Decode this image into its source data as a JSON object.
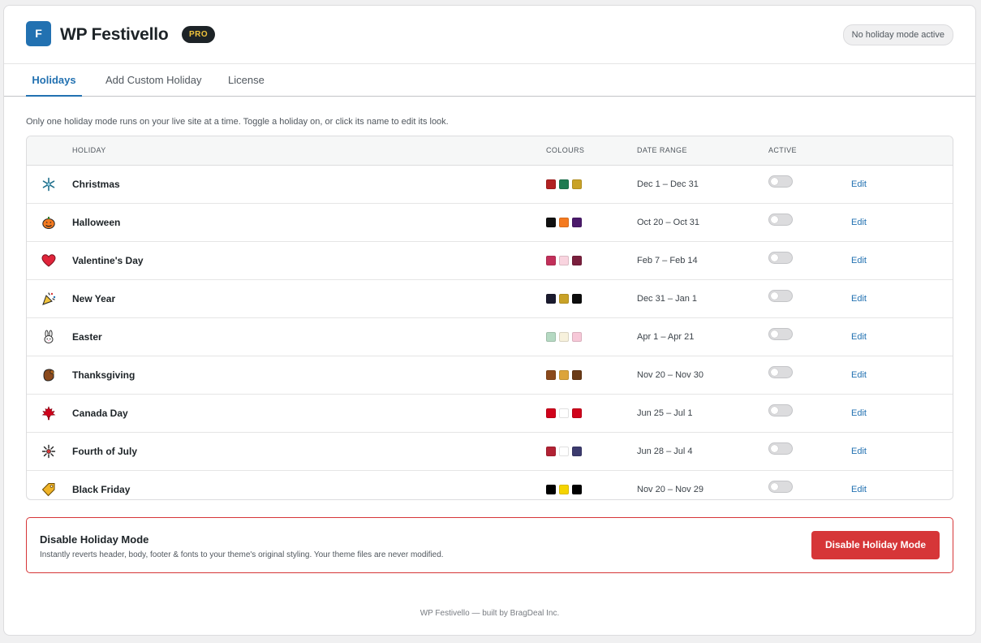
{
  "app": {
    "logo_letter": "F",
    "title": "WP Festivello",
    "badge": "PRO",
    "status": "No holiday mode active"
  },
  "tabs": [
    {
      "label": "Holidays",
      "active": true
    },
    {
      "label": "Add Custom Holiday",
      "active": false
    },
    {
      "label": "License",
      "active": false
    }
  ],
  "intro": "Only one holiday mode runs on your live site at a time. Toggle a holiday on, or click its name to edit its look.",
  "table": {
    "headers": {
      "holiday": "HOLIDAY",
      "colours": "COLOURS",
      "date_range": "DATE RANGE",
      "active": "ACTIVE"
    },
    "rows": [
      {
        "icon": "snowflake-icon",
        "name": "Christmas",
        "colors": [
          "#b22222",
          "#1e7b52",
          "#c9a227"
        ],
        "range": "Dec 1 – Dec 31",
        "active": false,
        "edit": "Edit"
      },
      {
        "icon": "pumpkin-icon",
        "name": "Halloween",
        "colors": [
          "#111111",
          "#f47a20",
          "#4b1a6b"
        ],
        "range": "Oct 20 – Oct 31",
        "active": false,
        "edit": "Edit"
      },
      {
        "icon": "heart-icon",
        "name": "Valentine's Day",
        "colors": [
          "#c2305a",
          "#f9d4df",
          "#7a1f3d"
        ],
        "range": "Feb 7 – Feb 14",
        "active": false,
        "edit": "Edit"
      },
      {
        "icon": "party-popper-icon",
        "name": "New Year",
        "colors": [
          "#1a1a2e",
          "#c9a227",
          "#0d0d0d"
        ],
        "range": "Dec 31 – Jan 1",
        "active": false,
        "edit": "Edit"
      },
      {
        "icon": "rabbit-icon",
        "name": "Easter",
        "colors": [
          "#b5d9c2",
          "#f7f1dc",
          "#f7c8d8"
        ],
        "range": "Apr 1 – Apr 21",
        "active": false,
        "edit": "Edit"
      },
      {
        "icon": "turkey-icon",
        "name": "Thanksgiving",
        "colors": [
          "#8b4a1c",
          "#dca43a",
          "#6a3a16"
        ],
        "range": "Nov 20 – Nov 30",
        "active": false,
        "edit": "Edit"
      },
      {
        "icon": "maple-leaf-icon",
        "name": "Canada Day",
        "colors": [
          "#d0021b",
          "#ffffff",
          "#d0021b"
        ],
        "range": "Jun 25 – Jul 1",
        "active": false,
        "edit": "Edit"
      },
      {
        "icon": "fireworks-icon",
        "name": "Fourth of July",
        "colors": [
          "#b22234",
          "#ffffff",
          "#3c3b6e"
        ],
        "range": "Jun 28 – Jul 4",
        "active": false,
        "edit": "Edit"
      },
      {
        "icon": "price-tag-icon",
        "name": "Black Friday",
        "colors": [
          "#000000",
          "#f5d400",
          "#000000"
        ],
        "range": "Nov 20 – Nov 29",
        "active": false,
        "edit": "Edit"
      }
    ]
  },
  "disable": {
    "title": "Disable Holiday Mode",
    "description": "Instantly reverts header, body, footer & fonts to your theme's original styling. Your theme files are never modified.",
    "button": "Disable Holiday Mode"
  },
  "footer": "WP Festivello — built by BragDeal Inc.",
  "theme": {
    "accent": "#2271b1",
    "danger": "#d63638"
  }
}
